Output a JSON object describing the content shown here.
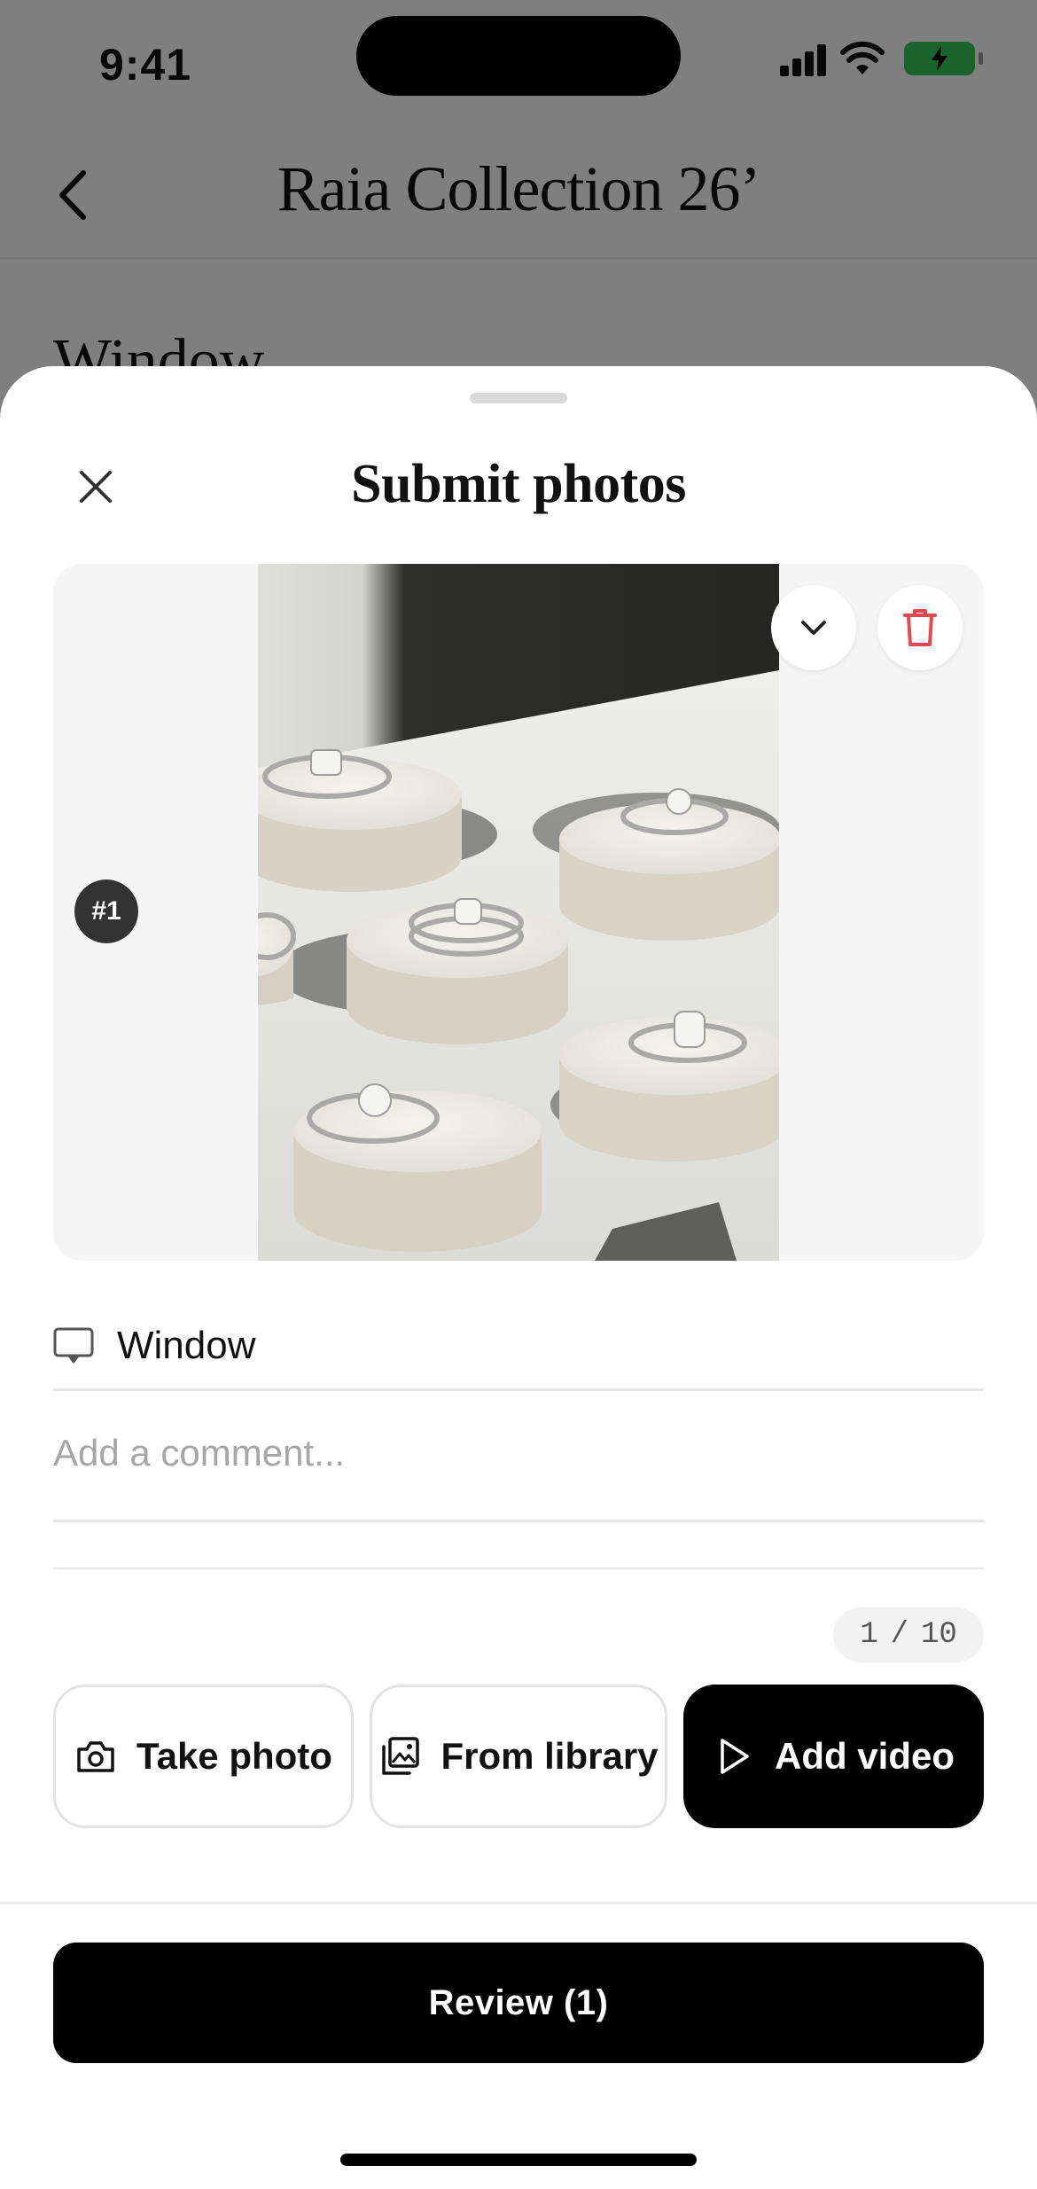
{
  "status_bar": {
    "time": "9:41"
  },
  "background_screen": {
    "title": "Raia Collection 26’",
    "section_title": "Window"
  },
  "sheet": {
    "title": "Submit photos",
    "media": {
      "index_label": "#1"
    },
    "location": {
      "label": "Window",
      "icon": "display-icon"
    },
    "comment": {
      "placeholder": "Add a comment...",
      "value": ""
    },
    "counter": {
      "current": "1",
      "separator": "/",
      "max": "10"
    },
    "actions": {
      "take_photo": "Take photo",
      "from_library": "From library",
      "add_video": "Add video"
    },
    "review_label": "Review (1)"
  },
  "colors": {
    "delete_red": "#e5484d",
    "battery_green": "#34c759",
    "primary": "#000000"
  }
}
